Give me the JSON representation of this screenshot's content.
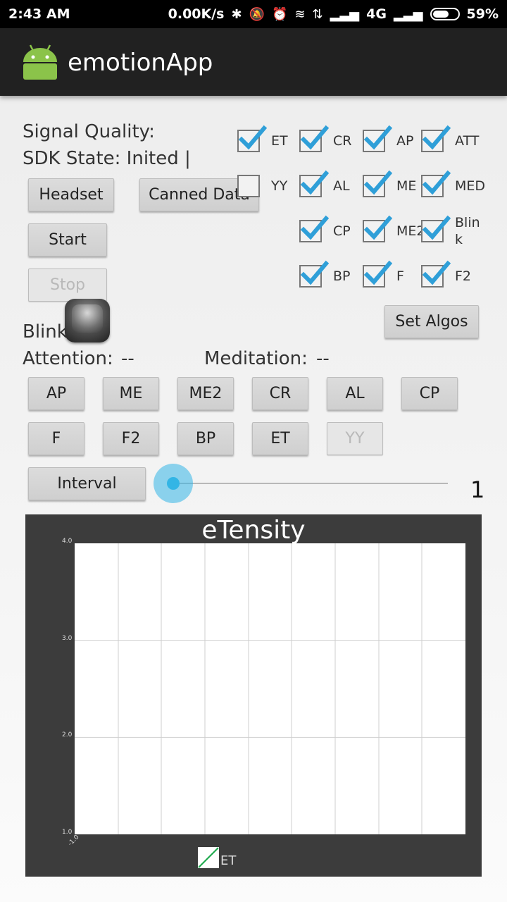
{
  "status_bar": {
    "time": "2:43 AM",
    "network_speed": "0.00K/s",
    "network_type": "4G",
    "battery": "59%"
  },
  "app_bar": {
    "title": "emotionApp"
  },
  "info": {
    "signal_quality": "Signal Quality:",
    "sdk_state": "SDK State: Inited |",
    "blink": "Blink",
    "attention_label": "Attention:",
    "attention_value": "--",
    "meditation_label": "Meditation:",
    "meditation_value": "--"
  },
  "buttons": {
    "headset": "Headset",
    "canned_data": "Canned Data",
    "start": "Start",
    "stop": "Stop",
    "set_algos": "Set Algos",
    "interval": "Interval"
  },
  "algo_checkboxes": [
    {
      "label": "ET",
      "checked": true
    },
    {
      "label": "CR",
      "checked": true
    },
    {
      "label": "AP",
      "checked": true
    },
    {
      "label": "ATT",
      "checked": true
    },
    {
      "label": "YY",
      "checked": false
    },
    {
      "label": "AL",
      "checked": true
    },
    {
      "label": "ME",
      "checked": true
    },
    {
      "label": "MED",
      "checked": true
    },
    {
      "label": "CP",
      "checked": true
    },
    {
      "label": "ME2",
      "checked": true
    },
    {
      "label": "Blin\nk",
      "checked": true
    },
    {
      "label": "BP",
      "checked": true
    },
    {
      "label": "F",
      "checked": true
    },
    {
      "label": "F2",
      "checked": true
    }
  ],
  "algo_buttons": [
    {
      "label": "AP",
      "enabled": true
    },
    {
      "label": "ME",
      "enabled": true
    },
    {
      "label": "ME2",
      "enabled": true
    },
    {
      "label": "CR",
      "enabled": true
    },
    {
      "label": "AL",
      "enabled": true
    },
    {
      "label": "CP",
      "enabled": true
    },
    {
      "label": "F",
      "enabled": true
    },
    {
      "label": "F2",
      "enabled": true
    },
    {
      "label": "BP",
      "enabled": true
    },
    {
      "label": "ET",
      "enabled": true
    },
    {
      "label": "YY",
      "enabled": false
    }
  ],
  "interval": {
    "value": "1"
  },
  "colors": {
    "accent": "#33b5e5",
    "check": "#2f9fd8",
    "chart_bg": "#3c3c3c",
    "series": "#1aa84a"
  },
  "chart_data": {
    "type": "line",
    "title": "eTensity",
    "series": [
      {
        "name": "ET",
        "values": []
      }
    ],
    "ylim": [
      1.0,
      4.0
    ],
    "y_ticks": [
      "4.0",
      "3.0",
      "2.0",
      "1.0"
    ],
    "x_ticks": [
      "-1.0"
    ],
    "grid": true,
    "legend": "bottom"
  }
}
